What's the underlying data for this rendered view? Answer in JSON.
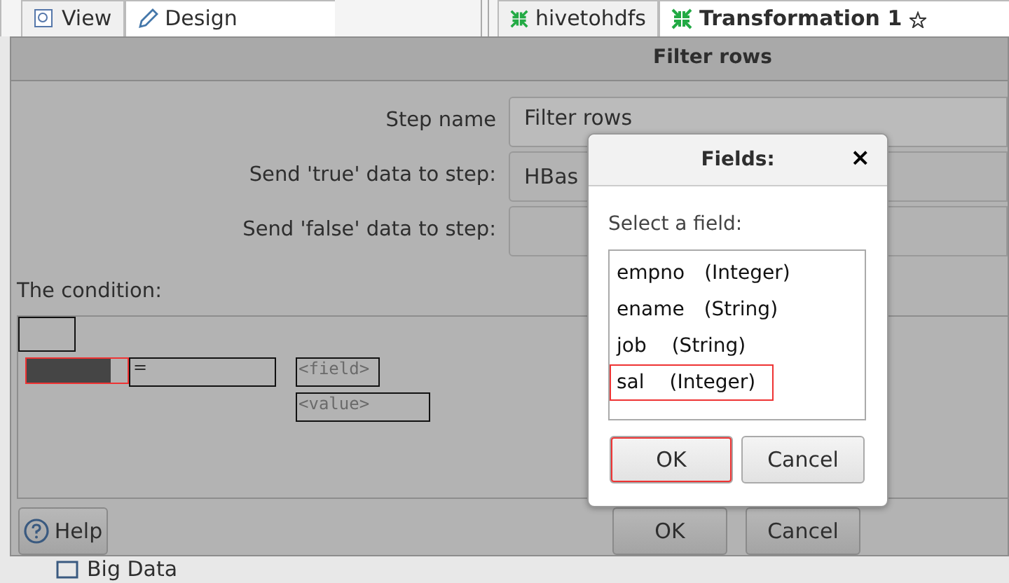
{
  "background_tabs": [
    {
      "label": "View",
      "selected": false
    },
    {
      "label": "Design",
      "selected": true
    },
    {
      "label": "hivetohdfs",
      "selected": false
    },
    {
      "label": "Transformation 1",
      "selected": true
    }
  ],
  "dialog": {
    "title": "Filter rows",
    "fields": [
      {
        "label": "Step name",
        "value": "Filter rows"
      },
      {
        "label": "Send 'true' data to step:",
        "value": "HBas"
      },
      {
        "label": "Send 'false' data to step:"
      }
    ],
    "condition_label": "The condition:",
    "condition": {
      "operator": "=",
      "field_text": "<field>",
      "value_text": "<value>",
      "highlighted": true
    },
    "buttons": [
      {
        "kind": "help",
        "label": "Help"
      },
      {
        "kind": "ok",
        "label": "OK"
      },
      {
        "kind": "cancel",
        "label": "Cancel"
      }
    ]
  },
  "fields_popup": {
    "title": "Fields:",
    "close": "×",
    "prompt": "Select a field:",
    "items": [
      {
        "name": "empno",
        "type": "(Integer)",
        "highlighted": false
      },
      {
        "name": "ename",
        "type": "(String)",
        "highlighted": false
      },
      {
        "name": "job",
        "type": "(String)",
        "highlighted": false
      },
      {
        "name": "sal",
        "type": "(Integer)",
        "highlighted": true
      }
    ],
    "buttons": [
      {
        "label": "OK",
        "highlighted": true
      },
      {
        "label": "Cancel",
        "highlighted": false
      }
    ]
  },
  "background_tree_item": "Big Data"
}
